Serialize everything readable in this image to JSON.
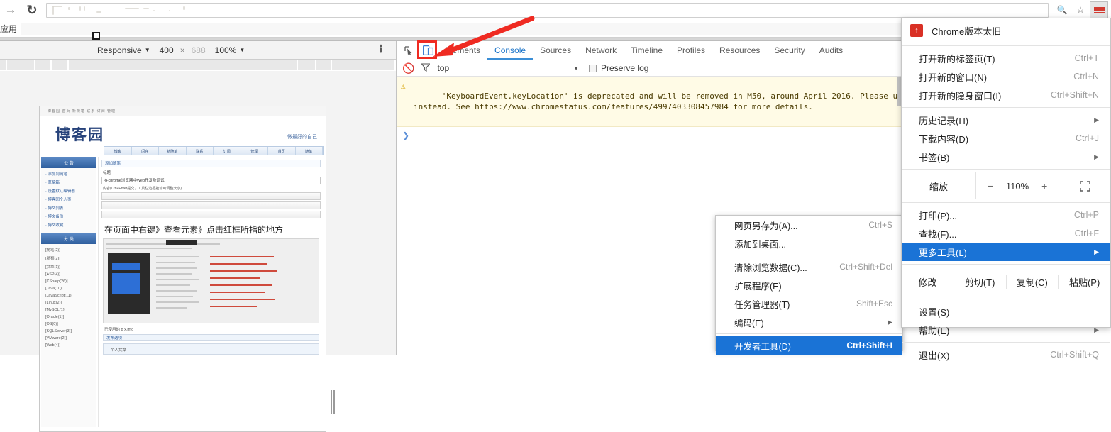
{
  "browser": {
    "back_icon": "forward-arrow-icon",
    "reload_icon": "reload-icon",
    "omnibox_value": "",
    "omnibox_placeholder": "",
    "zoom_icon": "zoom-search-icon",
    "bookmark_star_icon": "star-icon",
    "menu_icon": "hamburger-menu-icon",
    "bookmarks_label": "应用"
  },
  "device_toolbar": {
    "device_select": "Responsive",
    "caret": "▼",
    "width": "400",
    "times": "×",
    "height": "688",
    "zoom": "100%",
    "zoom_caret": "▼",
    "more_icon": "vertical-dots-icon"
  },
  "emulated_page": {
    "topnav": "· 博客园  首页  新随笔  联系  订阅  管理",
    "logo": "博客园",
    "tagline": "做最好的自己",
    "tabs": [
      "博客",
      "闪存",
      "新随笔",
      "联系",
      "订阅",
      "管理",
      "首页",
      "随笔"
    ],
    "sidebar_head_1": "公 告",
    "sidebar_items_1": [
      "· 添加到随笔",
      "· 草稿箱",
      "· 设置默认编辑器",
      "· 博客园个人页",
      "· 博文列表",
      "· 博文备份",
      "· 博文收藏"
    ],
    "sidebar_head_2": "分 类",
    "sidebar_items_2": [
      "[随笔(2)]",
      "[所有(2)]",
      "[文章(1)]",
      "[ASP(4)]",
      "[CSharp(26)]",
      "[Java(10)]",
      "[JavaScript(11)]",
      "[Linux(2)]",
      "[MySQL(1)]",
      "[Oracle(1)]",
      "[OS(0)]",
      "[SQLServer(3)]",
      "[VMware(2)]",
      "[Web(4)]"
    ],
    "editor_section_label": "添加随笔",
    "editor_title_label": "标题",
    "editor_title_value": "在chrome浏览器中Web开发及调试",
    "editor_content_label": "内容(Ctrl+Enter提交，工具栏边框拖动可调整大小)",
    "editor_headline": "在页面中右键》查看元素》点击红框所指的地方",
    "editor_footnote": "已使用的 p x.img",
    "bottom_section": "发布选项",
    "bottom_item": "个人文章"
  },
  "devtools": {
    "inspect_icon": "inspect-element-icon",
    "device_toolbar_icon": "toggle-device-toolbar-icon",
    "tabs": [
      {
        "label": "Elements",
        "active": false
      },
      {
        "label": "Console",
        "active": true
      },
      {
        "label": "Sources",
        "active": false
      },
      {
        "label": "Network",
        "active": false
      },
      {
        "label": "Timeline",
        "active": false
      },
      {
        "label": "Profiles",
        "active": false
      },
      {
        "label": "Resources",
        "active": false
      },
      {
        "label": "Security",
        "active": false
      },
      {
        "label": "Audits",
        "active": false
      }
    ],
    "clear_icon": "clear-console-icon",
    "filter_icon": "filter-funnel-icon",
    "context": "top",
    "context_caret": "▼",
    "preserve_log_label": "Preserve log",
    "warn_icon": "warning-triangle-icon",
    "warning_line1": "'KeyboardEvent.keyLocation' is deprecated and will be removed in M50, around April 2016. Please use 'Key",
    "warning_line2": "instead. See https://www.chromestatus.com/features/4997403308457984 for more details.",
    "prompt_chevron": "❯"
  },
  "submenu": {
    "items": [
      {
        "label": "网页另存为(A)...",
        "accel": "Ctrl+S",
        "arrow": false,
        "selected": false
      },
      {
        "label": "添加到桌面...",
        "accel": "",
        "arrow": false,
        "selected": false
      },
      {
        "sep": true
      },
      {
        "label": "清除浏览数据(C)...",
        "accel": "Ctrl+Shift+Del",
        "arrow": false,
        "selected": false
      },
      {
        "label": "扩展程序(E)",
        "accel": "",
        "arrow": false,
        "selected": false
      },
      {
        "label": "任务管理器(T)",
        "accel": "Shift+Esc",
        "arrow": false,
        "selected": false
      },
      {
        "label": "编码(E)",
        "accel": "",
        "arrow": true,
        "selected": false
      },
      {
        "sep": true
      },
      {
        "label": "开发者工具(D)",
        "accel": "Ctrl+Shift+I",
        "arrow": false,
        "selected": true
      }
    ]
  },
  "chrome_menu": {
    "header_label": "Chrome版本太旧",
    "header_icon": "update-alert-icon",
    "items_top": [
      {
        "label": "打开新的标签页(T)",
        "accel": "Ctrl+T",
        "arrow": false
      },
      {
        "label": "打开新的窗口(N)",
        "accel": "Ctrl+N",
        "arrow": false
      },
      {
        "label": "打开新的隐身窗口(I)",
        "accel": "Ctrl+Shift+N",
        "arrow": false
      }
    ],
    "items_mid": [
      {
        "label": "历史记录(H)",
        "accel": "",
        "arrow": true
      },
      {
        "label": "下载内容(D)",
        "accel": "Ctrl+J",
        "arrow": false
      },
      {
        "label": "书签(B)",
        "accel": "",
        "arrow": true
      }
    ],
    "zoom": {
      "label": "缩放",
      "minus": "−",
      "value": "110%",
      "plus": "+",
      "fullscreen_icon": "fullscreen-icon"
    },
    "items_after_zoom": [
      {
        "label": "打印(P)...",
        "accel": "Ctrl+P",
        "arrow": false,
        "selected": false
      },
      {
        "label": "查找(F)...",
        "accel": "Ctrl+F",
        "arrow": false,
        "selected": false
      },
      {
        "label": "更多工具(L)",
        "accel": "",
        "arrow": true,
        "selected": true
      }
    ],
    "edit_row": {
      "label": "修改",
      "cut": "剪切(T)",
      "copy": "复制(C)",
      "paste": "粘贴(P)"
    },
    "items_tail": [
      {
        "label": "设置(S)",
        "accel": "",
        "arrow": false
      },
      {
        "label": "帮助(E)",
        "accel": "",
        "arrow": true
      }
    ],
    "exit": {
      "label": "退出(X)",
      "accel": "Ctrl+Shift+Q"
    }
  },
  "annotations": {
    "redbox_target": "toggle-device-toolbar-icon",
    "arrow_color": "#ef2b22"
  }
}
